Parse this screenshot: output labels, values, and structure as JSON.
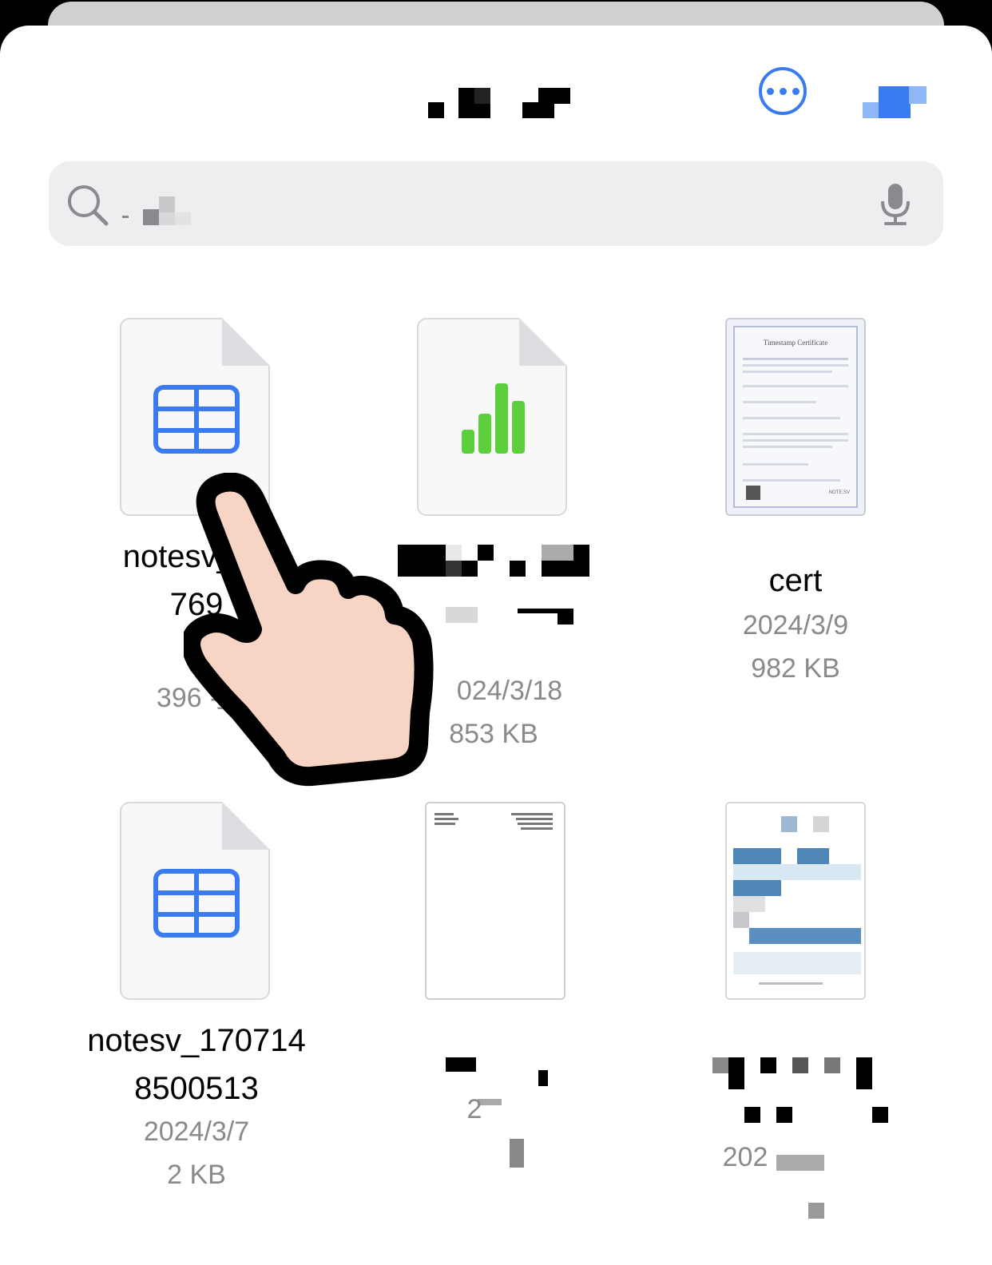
{
  "header": {
    "more_icon": "ellipsis-circle-icon"
  },
  "search": {
    "icon": "magnifying-glass-icon",
    "mic_icon": "microphone-icon"
  },
  "files": [
    {
      "name_line1": "notesv_17",
      "name_line2": "769",
      "meta1": "1:",
      "meta2": "396 字",
      "type": "numbers-table"
    },
    {
      "name_line1": "",
      "name_line2": "",
      "meta1": "024/3/18",
      "meta2": "853 KB",
      "type": "numbers-chart"
    },
    {
      "name_line1": "cert",
      "name_line2": "",
      "meta1": "2024/3/9",
      "meta2": "982 KB",
      "type": "certificate-image"
    },
    {
      "name_line1": "notesv_170714",
      "name_line2": "8500513",
      "meta1": "2024/3/7",
      "meta2": "2 KB",
      "type": "numbers-table"
    },
    {
      "name_line1": "",
      "name_line2": "",
      "meta1": "2",
      "meta2": "",
      "type": "document-page"
    },
    {
      "name_line1": "",
      "name_line2": "",
      "meta1": "202",
      "meta2": "",
      "type": "screenshot-image"
    }
  ],
  "certificate": {
    "title": "Timestamp Certificate",
    "brand": "NOTE.SV"
  },
  "colors": {
    "accent": "#3a7cf0",
    "chart_green": "#5ccf3c",
    "meta_gray": "#8a8a8e"
  }
}
